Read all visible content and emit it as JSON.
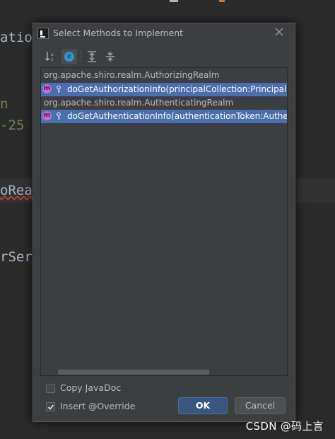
{
  "background_editor": {
    "lines": [
      "ation",
      "n",
      "-25",
      "oReal",
      "rServ"
    ]
  },
  "dialog": {
    "title": "Select Methods to Implement",
    "toolbar": {
      "sort_icon": "sort-alphabetically-icon",
      "class_icon_letter": "c",
      "expand_icon": "expand-all-icon",
      "collapse_icon": "collapse-all-icon"
    },
    "tree": {
      "groups": [
        {
          "name": "org.apache.shiro.realm.AuthorizingRealm",
          "method": "doGetAuthorizationInfo(principalCollection:PrincipalColl"
        },
        {
          "name": "org.apache.shiro.realm.AuthenticatingRealm",
          "method": "doGetAuthenticationInfo(authenticationToken:Authentica"
        }
      ],
      "method_icon_letter": "m"
    },
    "options": {
      "copy_javadoc": {
        "label": "Copy JavaDoc",
        "checked": false
      },
      "insert_override": {
        "label": "Insert @Override",
        "checked": true
      }
    },
    "buttons": {
      "ok": "OK",
      "cancel": "Cancel"
    }
  },
  "watermark": "CSDN @码上言",
  "colors": {
    "dialog_bg": "#3c3f41",
    "selection": "#4b6eaf",
    "ok_button": "#365880",
    "method_icon": "#c56dd4",
    "class_icon": "#3592c4"
  }
}
